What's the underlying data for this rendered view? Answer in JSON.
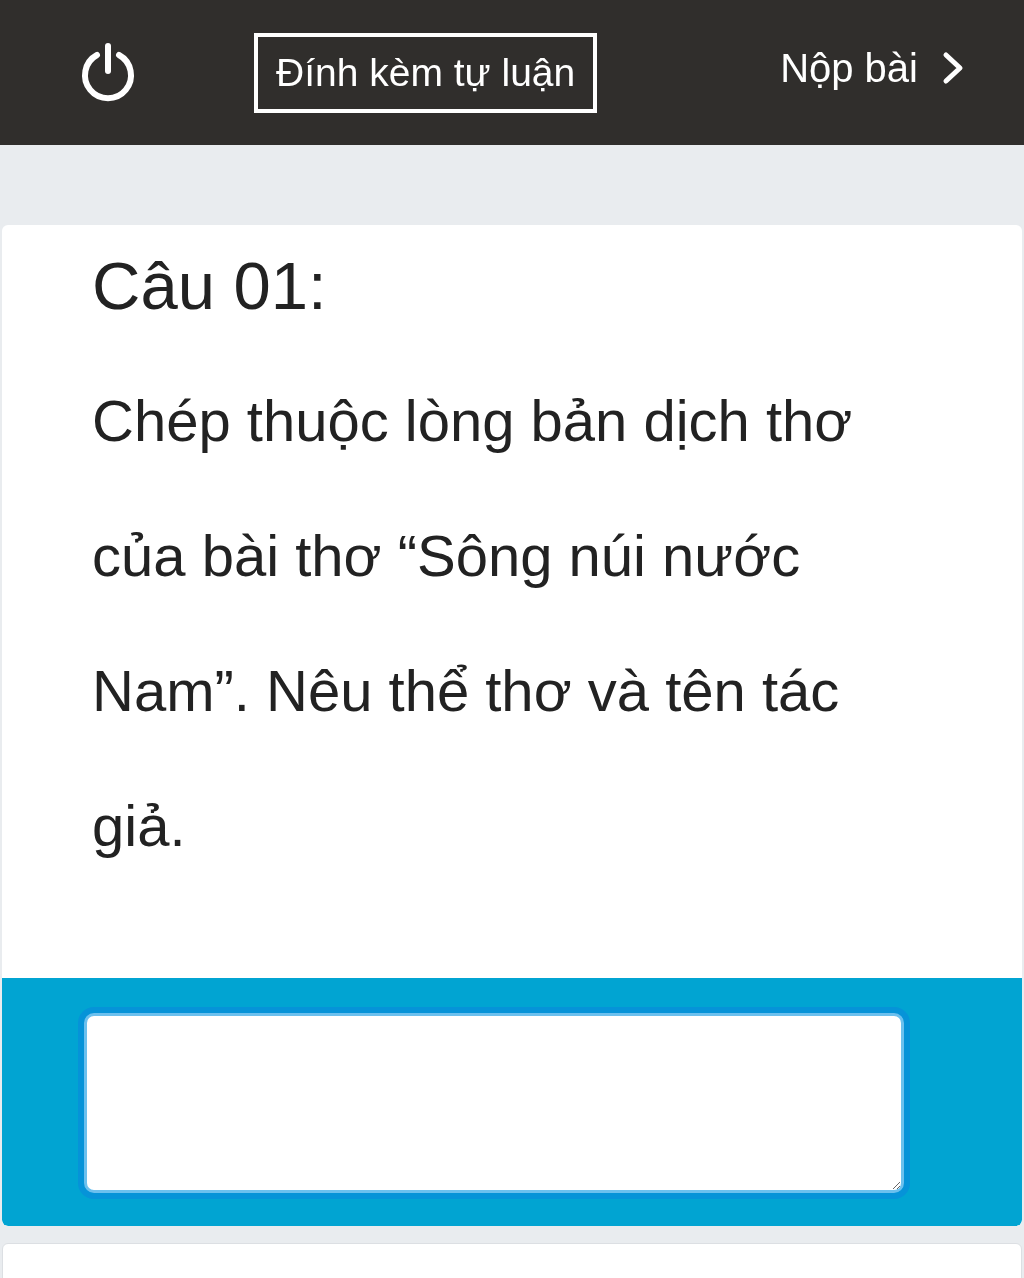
{
  "header": {
    "attach_button": "Đính kèm tự luận",
    "submit_button": "Nộp bài"
  },
  "question": {
    "title": "Câu 01:",
    "text": "Chép thuộc lòng bản dịch thơ của bài thơ “Sông núi nước Nam”. Nêu thể thơ và tên tác giả."
  }
}
